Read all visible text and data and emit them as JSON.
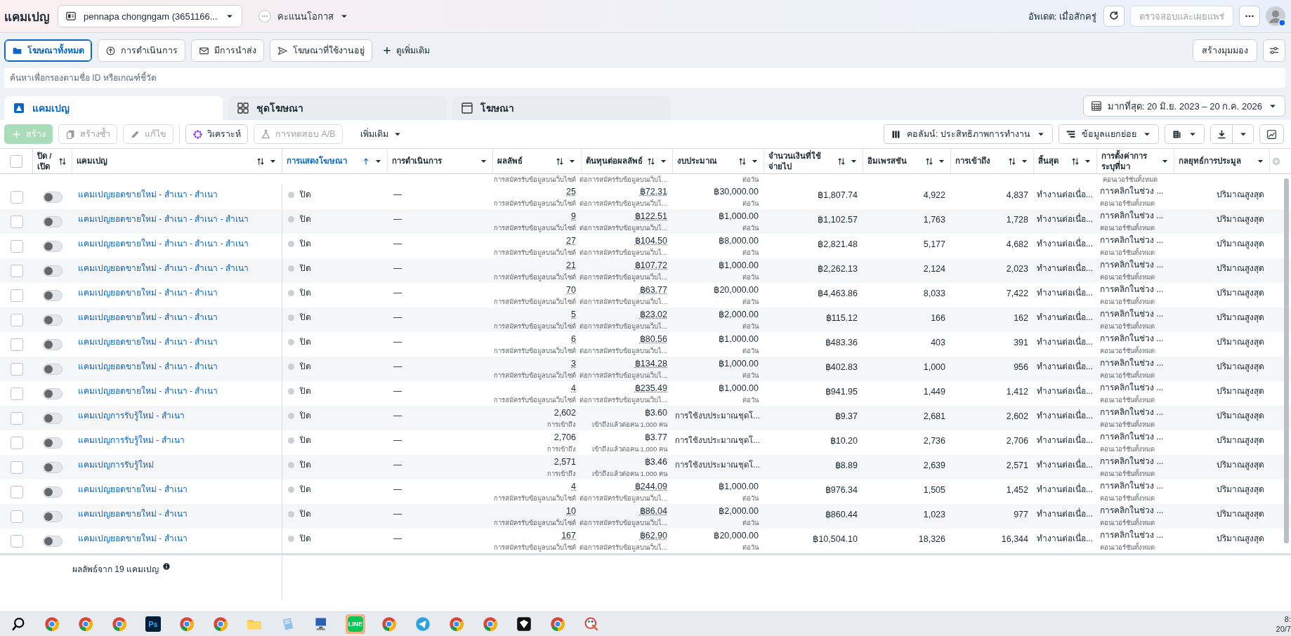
{
  "header": {
    "title": "แคมเปญ",
    "account": "pennapa chongngam (3651166...",
    "score_label": "คะแนนโอกาส",
    "updated": "อัพเดต: เมื่อสักครู่",
    "publish_button": {
      "label": "ตรวจสอบและเผยแพร่",
      "disabled": true
    }
  },
  "filter_tabs": [
    {
      "label": "โฆษณาทั้งหมด",
      "selected": true
    },
    {
      "label": "การดำเนินการ",
      "selected": false
    },
    {
      "label": "มีการนำส่ง",
      "selected": false
    },
    {
      "label": "โฆษณาที่ใช้งานอยู่",
      "selected": false
    }
  ],
  "more_filters": "ดูเพิ่มเติม",
  "create_view": "สร้างมุมมอง",
  "search": {
    "placeholder": "ค้นหาเพื่อกรองตามชื่อ ID หรือเกณฑ์ชี้วัด"
  },
  "level_tabs": [
    {
      "label": "แคมเปญ",
      "selected": true
    },
    {
      "label": "ชุดโฆษณา",
      "selected": false
    },
    {
      "label": "โฆษณา",
      "selected": false
    }
  ],
  "date_range": "มากที่สุด: 20 มิ.ย. 2023 – 20 ก.ค. 2026",
  "toolbar": {
    "actions": [
      {
        "label": "สร้าง",
        "kind": "primary",
        "disabled": true
      },
      {
        "label": "สร้างซ้ำ",
        "kind": "plain",
        "disabled": true
      },
      {
        "label": "แก้ไข",
        "kind": "plain",
        "disabled": true
      },
      {
        "label": "วิเคราะห์",
        "kind": "plain",
        "disabled": false
      },
      {
        "label": "การทดสอบ A/B",
        "kind": "plain",
        "disabled": true
      },
      {
        "label": "เพิ่มเติม",
        "kind": "menu",
        "disabled": false
      }
    ],
    "columns_button": "คอลัมน์: ประสิทธิภาพการทำงาน",
    "breakdown_button": "ข้อมูลแยกย่อย"
  },
  "table": {
    "all_checked": false,
    "columns": [
      {
        "label": "ปิด / เปิด",
        "sortable": true,
        "sorted": false,
        "menu": false
      },
      {
        "label": "แคมเปญ",
        "sortable": true,
        "sorted": false,
        "menu": true
      },
      {
        "label": "การแสดงโฆษณา",
        "sortable": true,
        "sorted": true,
        "menu": true
      },
      {
        "label": "การดำเนินการ",
        "sortable": false,
        "sorted": false,
        "menu": true
      },
      {
        "label": "ผลลัพธ์",
        "sortable": true,
        "sorted": false,
        "menu": true
      },
      {
        "label": "ต้นทุนต่อผลลัพธ์",
        "sortable": true,
        "sorted": false,
        "menu": true
      },
      {
        "label": "งบประมาณ",
        "sortable": true,
        "sorted": false,
        "menu": true
      },
      {
        "label": "จำนวนเงินที่ใช้จ่ายไป",
        "sortable": true,
        "sorted": false,
        "menu": true
      },
      {
        "label": "อิมเพรสชัน",
        "sortable": true,
        "sorted": false,
        "menu": true
      },
      {
        "label": "การเข้าถึง",
        "sortable": true,
        "sorted": false,
        "menu": true
      },
      {
        "label": "สิ้นสุด",
        "sortable": true,
        "sorted": false,
        "menu": true
      },
      {
        "label": "การตั้งค่าการระบุที่มา",
        "sortable": false,
        "sorted": false,
        "menu": true
      },
      {
        "label": "กลยุทธ์การประมูล",
        "sortable": false,
        "sorted": false,
        "menu": true
      }
    ],
    "clipped_row": {
      "result_label": "การสมัครรับข้อมูลบนเว็บไซต์",
      "cost_label": "ต่อการสมัครรับข้อมูลบนเว็บไ...",
      "budget_label": "ต่อวัน",
      "attribution_label": "คอนเวอร์ชันทั้งหมด"
    },
    "rows": [
      {
        "name": "แคมเปญยอดขายใหม่ - สำเนา - สำเนา",
        "kind": "conversion",
        "checked": false,
        "on": false,
        "status": "ปิด",
        "action": "—",
        "result": "25",
        "result_label": "การสมัครรับข้อมูลบนเว็บไซต์",
        "cost": "฿72.31",
        "cost_label": "ต่อการสมัครรับข้อมูลบนเว็บไ...",
        "budget": "฿30,000.00",
        "budget_label": "ต่อวัน",
        "spent": "฿1,807.74",
        "impressions": "4,922",
        "reach": "4,837",
        "ends": "ทำงานต่อเนื่อ...",
        "attribution": "การคลิกในช่วง ...",
        "attribution_label": "คอนเวอร์ชันทั้งหมด",
        "bid_strategy": "ปริมาณสูงสุด"
      },
      {
        "name": "แคมเปญยอดขายใหม่ - สำเนา - สำเนา - สำเนา",
        "kind": "conversion",
        "checked": false,
        "on": false,
        "status": "ปิด",
        "action": "—",
        "result": "9",
        "result_label": "การสมัครรับข้อมูลบนเว็บไซต์",
        "cost": "฿122.51",
        "cost_label": "ต่อการสมัครรับข้อมูลบนเว็บไ...",
        "budget": "฿1,000.00",
        "budget_label": "ต่อวัน",
        "spent": "฿1,102.57",
        "impressions": "1,763",
        "reach": "1,728",
        "ends": "ทำงานต่อเนื่อ...",
        "attribution": "การคลิกในช่วง ...",
        "attribution_label": "คอนเวอร์ชันทั้งหมด",
        "bid_strategy": "ปริมาณสูงสุด"
      },
      {
        "name": "แคมเปญยอดขายใหม่ - สำเนา - สำเนา - สำเนา",
        "kind": "conversion",
        "checked": false,
        "on": false,
        "status": "ปิด",
        "action": "—",
        "result": "27",
        "result_label": "การสมัครรับข้อมูลบนเว็บไซต์",
        "cost": "฿104.50",
        "cost_label": "ต่อการสมัครรับข้อมูลบนเว็บไ...",
        "budget": "฿8,000.00",
        "budget_label": "ต่อวัน",
        "spent": "฿2,821.48",
        "impressions": "5,177",
        "reach": "4,682",
        "ends": "ทำงานต่อเนื่อ...",
        "attribution": "การคลิกในช่วง ...",
        "attribution_label": "คอนเวอร์ชันทั้งหมด",
        "bid_strategy": "ปริมาณสูงสุด"
      },
      {
        "name": "แคมเปญยอดขายใหม่ - สำเนา - สำเนา - สำเนา",
        "kind": "conversion",
        "checked": false,
        "on": false,
        "status": "ปิด",
        "action": "—",
        "result": "21",
        "result_label": "การสมัครรับข้อมูลบนเว็บไซต์",
        "cost": "฿107.72",
        "cost_label": "ต่อการสมัครรับข้อมูลบนเว็บไ...",
        "budget": "฿1,000.00",
        "budget_label": "ต่อวัน",
        "spent": "฿2,262.13",
        "impressions": "2,124",
        "reach": "2,023",
        "ends": "ทำงานต่อเนื่อ...",
        "attribution": "การคลิกในช่วง ...",
        "attribution_label": "คอนเวอร์ชันทั้งหมด",
        "bid_strategy": "ปริมาณสูงสุด"
      },
      {
        "name": "แคมเปญยอดขายใหม่ - สำเนา - สำเนา",
        "kind": "conversion",
        "checked": false,
        "on": false,
        "status": "ปิด",
        "action": "—",
        "result": "70",
        "result_label": "การสมัครรับข้อมูลบนเว็บไซต์",
        "cost": "฿63.77",
        "cost_label": "ต่อการสมัครรับข้อมูลบนเว็บไ...",
        "budget": "฿20,000.00",
        "budget_label": "ต่อวัน",
        "spent": "฿4,463.86",
        "impressions": "8,033",
        "reach": "7,422",
        "ends": "ทำงานต่อเนื่อ...",
        "attribution": "การคลิกในช่วง ...",
        "attribution_label": "คอนเวอร์ชันทั้งหมด",
        "bid_strategy": "ปริมาณสูงสุด"
      },
      {
        "name": "แคมเปญยอดขายใหม่ - สำเนา - สำเนา",
        "kind": "conversion",
        "checked": false,
        "on": false,
        "status": "ปิด",
        "action": "—",
        "result": "5",
        "result_label": "การสมัครรับข้อมูลบนเว็บไซต์",
        "cost": "฿23.02",
        "cost_label": "ต่อการสมัครรับข้อมูลบนเว็บไ...",
        "budget": "฿2,000.00",
        "budget_label": "ต่อวัน",
        "spent": "฿115.12",
        "impressions": "166",
        "reach": "162",
        "ends": "ทำงานต่อเนื่อ...",
        "attribution": "การคลิกในช่วง ...",
        "attribution_label": "คอนเวอร์ชันทั้งหมด",
        "bid_strategy": "ปริมาณสูงสุด"
      },
      {
        "name": "แคมเปญยอดขายใหม่ - สำเนา - สำเนา",
        "kind": "conversion",
        "checked": false,
        "on": false,
        "status": "ปิด",
        "action": "—",
        "result": "6",
        "result_label": "การสมัครรับข้อมูลบนเว็บไซต์",
        "cost": "฿80.56",
        "cost_label": "ต่อการสมัครรับข้อมูลบนเว็บไ...",
        "budget": "฿1,000.00",
        "budget_label": "ต่อวัน",
        "spent": "฿483.36",
        "impressions": "403",
        "reach": "391",
        "ends": "ทำงานต่อเนื่อ...",
        "attribution": "การคลิกในช่วง ...",
        "attribution_label": "คอนเวอร์ชันทั้งหมด",
        "bid_strategy": "ปริมาณสูงสุด"
      },
      {
        "name": "แคมเปญยอดขายใหม่ - สำเนา - สำเนา",
        "kind": "conversion",
        "checked": false,
        "on": false,
        "status": "ปิด",
        "action": "—",
        "result": "3",
        "result_label": "การสมัครรับข้อมูลบนเว็บไซต์",
        "cost": "฿134.28",
        "cost_label": "ต่อการสมัครรับข้อมูลบนเว็บไ...",
        "budget": "฿1,000.00",
        "budget_label": "ต่อวัน",
        "spent": "฿402.83",
        "impressions": "1,000",
        "reach": "956",
        "ends": "ทำงานต่อเนื่อ...",
        "attribution": "การคลิกในช่วง ...",
        "attribution_label": "คอนเวอร์ชันทั้งหมด",
        "bid_strategy": "ปริมาณสูงสุด"
      },
      {
        "name": "แคมเปญยอดขายใหม่ - สำเนา - สำเนา",
        "kind": "conversion",
        "checked": false,
        "on": false,
        "status": "ปิด",
        "action": "—",
        "result": "4",
        "result_label": "การสมัครรับข้อมูลบนเว็บไซต์",
        "cost": "฿235.49",
        "cost_label": "ต่อการสมัครรับข้อมูลบนเว็บไ...",
        "budget": "฿1,000.00",
        "budget_label": "ต่อวัน",
        "spent": "฿941.95",
        "impressions": "1,449",
        "reach": "1,412",
        "ends": "ทำงานต่อเนื่อ...",
        "attribution": "การคลิกในช่วง ...",
        "attribution_label": "คอนเวอร์ชันทั้งหมด",
        "bid_strategy": "ปริมาณสูงสุด"
      },
      {
        "name": "แคมเปญการรับรู้ใหม่ - สำเนา",
        "kind": "reach",
        "checked": false,
        "on": false,
        "status": "ปิด",
        "action": "—",
        "result": "2,602",
        "result_label": "การเข้าถึง",
        "cost": "฿3.60",
        "cost_label": "เข้าถึงแล้วต่อคน 1,000 คน",
        "budget": "การใช้งบประมาณชุดโ...",
        "spent": "฿9.37",
        "impressions": "2,681",
        "reach": "2,602",
        "ends": "ทำงานต่อเนื่อ...",
        "attribution": "การคลิกในช่วง ...",
        "attribution_label": "คอนเวอร์ชันทั้งหมด",
        "bid_strategy": "ปริมาณสูงสุด"
      },
      {
        "name": "แคมเปญการรับรู้ใหม่ - สำเนา",
        "kind": "reach",
        "checked": false,
        "on": false,
        "status": "ปิด",
        "action": "—",
        "result": "2,706",
        "result_label": "การเข้าถึง",
        "cost": "฿3.77",
        "cost_label": "เข้าถึงแล้วต่อคน 1,000 คน",
        "budget": "การใช้งบประมาณชุดโ...",
        "spent": "฿10.20",
        "impressions": "2,736",
        "reach": "2,706",
        "ends": "ทำงานต่อเนื่อ...",
        "attribution": "การคลิกในช่วง ...",
        "attribution_label": "คอนเวอร์ชันทั้งหมด",
        "bid_strategy": "ปริมาณสูงสุด"
      },
      {
        "name": "แคมเปญการรับรู้ใหม่",
        "kind": "reach",
        "checked": false,
        "on": false,
        "status": "ปิด",
        "action": "—",
        "result": "2,571",
        "result_label": "การเข้าถึง",
        "cost": "฿3.46",
        "cost_label": "เข้าถึงแล้วต่อคน 1,000 คน",
        "budget": "การใช้งบประมาณชุดโ...",
        "spent": "฿8.89",
        "impressions": "2,639",
        "reach": "2,571",
        "ends": "ทำงานต่อเนื่อ...",
        "attribution": "การคลิกในช่วง ...",
        "attribution_label": "คอนเวอร์ชันทั้งหมด",
        "bid_strategy": "ปริมาณสูงสุด"
      },
      {
        "name": "แคมเปญยอดขายใหม่ - สำเนา",
        "kind": "conversion",
        "checked": false,
        "on": false,
        "status": "ปิด",
        "action": "—",
        "result": "4",
        "result_label": "การสมัครรับข้อมูลบนเว็บไซต์",
        "cost": "฿244.09",
        "cost_label": "ต่อการสมัครรับข้อมูลบนเว็บไ...",
        "budget": "฿1,000.00",
        "budget_label": "ต่อวัน",
        "spent": "฿976.34",
        "impressions": "1,505",
        "reach": "1,452",
        "ends": "ทำงานต่อเนื่อ...",
        "attribution": "การคลิกในช่วง ...",
        "attribution_label": "คอนเวอร์ชันทั้งหมด",
        "bid_strategy": "ปริมาณสูงสุด"
      },
      {
        "name": "แคมเปญยอดขายใหม่ - สำเนา",
        "kind": "conversion",
        "checked": false,
        "on": false,
        "status": "ปิด",
        "action": "—",
        "result": "10",
        "result_label": "การสมัครรับข้อมูลบนเว็บไซต์",
        "cost": "฿86.04",
        "cost_label": "ต่อการสมัครรับข้อมูลบนเว็บไ...",
        "budget": "฿2,000.00",
        "budget_label": "ต่อวัน",
        "spent": "฿860.44",
        "impressions": "1,023",
        "reach": "977",
        "ends": "ทำงานต่อเนื่อ...",
        "attribution": "การคลิกในช่วง ...",
        "attribution_label": "คอนเวอร์ชันทั้งหมด",
        "bid_strategy": "ปริมาณสูงสุด"
      },
      {
        "name": "แคมเปญยอดขายใหม่ - สำเนา",
        "kind": "conversion",
        "checked": false,
        "on": false,
        "status": "ปิด",
        "action": "—",
        "result": "167",
        "result_label": "การสมัครรับข้อมูลบนเว็บไซต์",
        "cost": "฿62.90",
        "cost_label": "ต่อการสมัครรับข้อมูลบนเว็บไ...",
        "budget": "฿20,000.00",
        "budget_label": "ต่อวัน",
        "spent": "฿10,504.10",
        "impressions": "18,326",
        "reach": "16,344",
        "ends": "ทำงานต่อเนื่อ...",
        "attribution": "การคลิกในช่วง ...",
        "attribution_label": "คอนเวอร์ชันทั้งหมด",
        "bid_strategy": "ปริมาณสูงสุด"
      }
    ],
    "footer": "ผลลัพธ์จาก 19 แคมเปญ"
  },
  "taskbar": {
    "apps": [
      {
        "kind": "search",
        "active": false
      },
      {
        "kind": "browser",
        "active": false
      },
      {
        "kind": "browser",
        "active": false
      },
      {
        "kind": "browser",
        "active": false
      },
      {
        "kind": "photoshop",
        "label": "Ps",
        "active": false
      },
      {
        "kind": "browser",
        "active": false
      },
      {
        "kind": "browser",
        "active": false
      },
      {
        "kind": "folder",
        "active": false
      },
      {
        "kind": "notepad",
        "active": false
      },
      {
        "kind": "computer",
        "active": false
      },
      {
        "kind": "line",
        "label": "LINE",
        "active": true
      },
      {
        "kind": "browser",
        "active": false
      },
      {
        "kind": "telegram",
        "active": false
      },
      {
        "kind": "browser",
        "active": false
      },
      {
        "kind": "browser",
        "active": false
      },
      {
        "kind": "cube",
        "active": false
      },
      {
        "kind": "browser",
        "active": false
      },
      {
        "kind": "paint",
        "active": false
      }
    ],
    "time": "8:",
    "date": "20/7"
  }
}
